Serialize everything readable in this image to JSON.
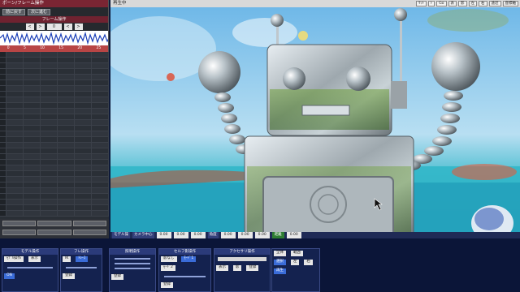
{
  "left_panel": {
    "title": "ボーン/フレーム操作",
    "buttons": [
      "前に戻す",
      "次に進む"
    ],
    "frame_label": "フレーム操作",
    "frame_nav": [
      "<",
      ">",
      "0",
      "<",
      ">"
    ],
    "ruler_ticks": [
      "0",
      "5",
      "10",
      "15",
      "20",
      "25"
    ]
  },
  "viewport": {
    "title": "再生中",
    "tools": [
      "ｾｯﾄ",
      "ﾄ",
      "Go",
      "表",
      "影",
      "左",
      "右",
      "遠近",
      "座標軸"
    ],
    "status": {
      "model_label": "モデル操",
      "camera_label": "カメラ中心",
      "values": [
        "0.00",
        "0.00",
        "0.00",
        "0.00"
      ],
      "angle_label": "角度",
      "angle_values": [
        "0.00",
        "0.00",
        "0.00"
      ],
      "distance_label": "距離",
      "distance_value": "0.00"
    }
  },
  "bottom": {
    "model_panel": {
      "title": "モデル操作",
      "buttons": [
        "ﾓﾃﾞﾙ操作",
        "表示",
        "ON"
      ]
    },
    "frame_panel": {
      "title": "フレ操作",
      "buttons": [
        "IK",
        "ﾄﾚｰｽ",
        "登録"
      ]
    },
    "camera_panel": {
      "title": "照明操作",
      "buttons": [
        "登録"
      ]
    },
    "self_panel": {
      "title": "セルフ影操作",
      "buttons": [
        "影なし",
        "ﾓｰﾄﾞ1",
        "ﾓｰﾄﾞ2",
        "登録"
      ]
    },
    "accessory_panel": {
      "title": "アクセサリ操作",
      "buttons": [
        "表示",
        "影",
        "登録"
      ]
    },
    "right_panel": {
      "buttons": [
        "全体",
        "範囲",
        "選択",
        "左",
        "右",
        "再生"
      ]
    }
  }
}
